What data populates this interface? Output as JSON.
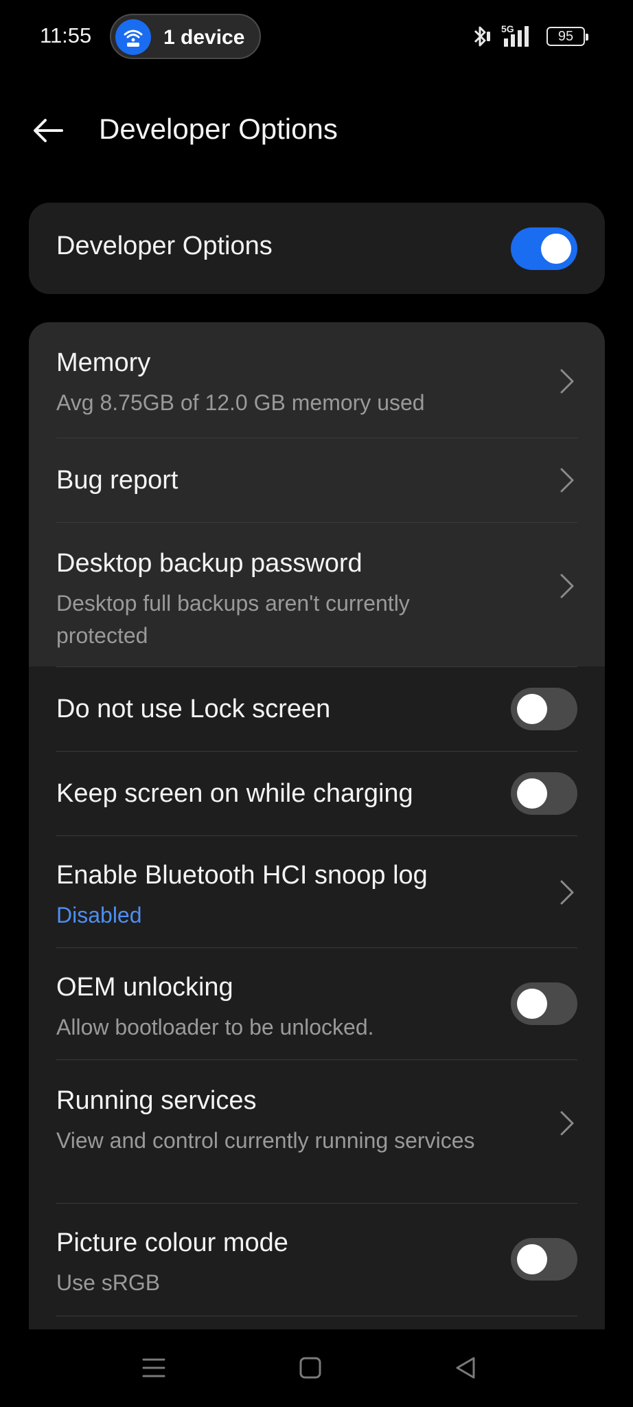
{
  "status_bar": {
    "time": "11:55",
    "hotspot_label": "1 device",
    "network": "5G",
    "battery": "95"
  },
  "header": {
    "title": "Developer Options"
  },
  "master_toggle": {
    "label": "Developer Options",
    "enabled": true
  },
  "settings": [
    {
      "title": "Memory",
      "subtitle": "Avg 8.75GB of 12.0 GB memory used",
      "control": "chevron"
    },
    {
      "title": "Bug report",
      "subtitle": "",
      "control": "chevron"
    },
    {
      "title": "Desktop backup password",
      "subtitle": "Desktop full backups aren't currently protected",
      "control": "chevron"
    },
    {
      "title": "Do not use Lock screen",
      "subtitle": "",
      "control": "toggle",
      "enabled": false
    },
    {
      "title": "Keep screen on while charging",
      "subtitle": "",
      "control": "toggle",
      "enabled": false
    },
    {
      "title": "Enable Bluetooth HCI snoop log",
      "subtitle": "Disabled",
      "control": "chevron"
    },
    {
      "title": "OEM unlocking",
      "subtitle": "Allow bootloader to be unlocked.",
      "control": "toggle",
      "enabled": false
    },
    {
      "title": "Running services",
      "subtitle": "View and control currently running services",
      "control": "chevron"
    },
    {
      "title": "Picture colour mode",
      "subtitle": "Use sRGB",
      "control": "toggle",
      "enabled": false
    }
  ],
  "colors": {
    "accent": "#1a6cf0",
    "link": "#4e8ef2",
    "background": "#000000",
    "card": "#1e1e1e"
  },
  "nav_bar": {
    "icons": [
      "menu-icon",
      "home-square-icon",
      "back-triangle-icon"
    ]
  }
}
